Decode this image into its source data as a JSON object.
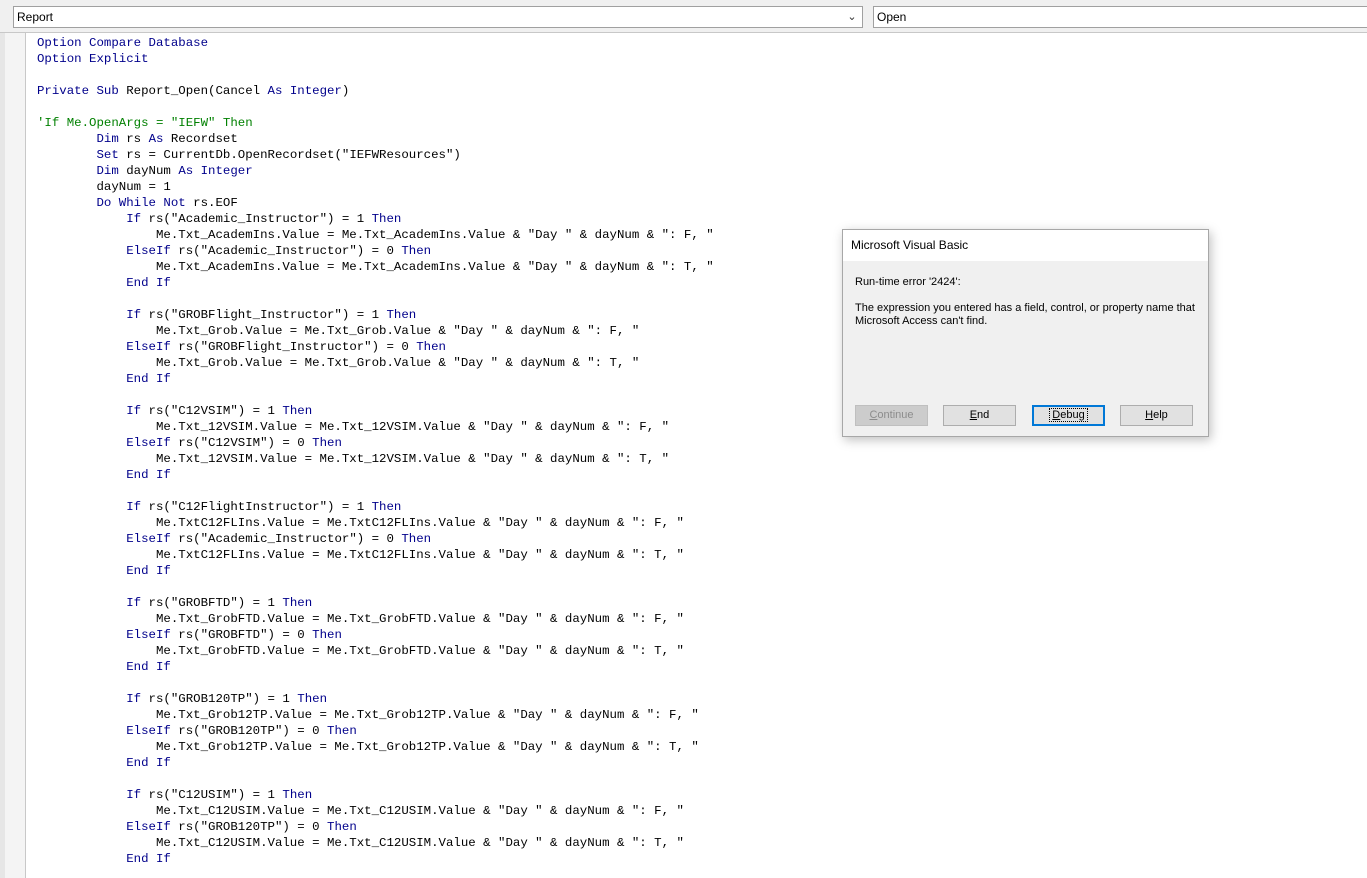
{
  "toolbar": {
    "object_combo": "Report",
    "procedure_combo": "Open"
  },
  "code_lines": [
    [
      {
        "t": "Option Compare Database",
        "c": "kw"
      }
    ],
    [
      {
        "t": "Option Explicit",
        "c": "kw"
      }
    ],
    [
      {
        "t": "",
        "c": ""
      }
    ],
    [
      {
        "t": "Private Sub",
        "c": "kw"
      },
      {
        "t": " Report_Open(Cancel ",
        "c": ""
      },
      {
        "t": "As Integer",
        "c": "kw"
      },
      {
        "t": ")",
        "c": ""
      }
    ],
    [
      {
        "t": "",
        "c": ""
      }
    ],
    [
      {
        "t": "'If Me.OpenArgs = \"IEFW\" Then",
        "c": "cm"
      }
    ],
    [
      {
        "t": "        ",
        "c": ""
      },
      {
        "t": "Dim",
        "c": "kw"
      },
      {
        "t": " rs ",
        "c": ""
      },
      {
        "t": "As",
        "c": "kw"
      },
      {
        "t": " Recordset",
        "c": ""
      }
    ],
    [
      {
        "t": "        ",
        "c": ""
      },
      {
        "t": "Set",
        "c": "kw"
      },
      {
        "t": " rs = CurrentDb.OpenRecordset(\"IEFWResources\")",
        "c": ""
      }
    ],
    [
      {
        "t": "        ",
        "c": ""
      },
      {
        "t": "Dim",
        "c": "kw"
      },
      {
        "t": " dayNum ",
        "c": ""
      },
      {
        "t": "As Integer",
        "c": "kw"
      }
    ],
    [
      {
        "t": "        dayNum = 1",
        "c": ""
      }
    ],
    [
      {
        "t": "        ",
        "c": ""
      },
      {
        "t": "Do While Not",
        "c": "kw"
      },
      {
        "t": " rs.EOF",
        "c": ""
      }
    ],
    [
      {
        "t": "            ",
        "c": ""
      },
      {
        "t": "If",
        "c": "kw"
      },
      {
        "t": " rs(\"Academic_Instructor\") = 1 ",
        "c": ""
      },
      {
        "t": "Then",
        "c": "kw"
      }
    ],
    [
      {
        "t": "                Me.Txt_AcademIns.Value = Me.Txt_AcademIns.Value & \"Day \" & dayNum & \": F, \"",
        "c": ""
      }
    ],
    [
      {
        "t": "            ",
        "c": ""
      },
      {
        "t": "ElseIf",
        "c": "kw"
      },
      {
        "t": " rs(\"Academic_Instructor\") = 0 ",
        "c": ""
      },
      {
        "t": "Then",
        "c": "kw"
      }
    ],
    [
      {
        "t": "                Me.Txt_AcademIns.Value = Me.Txt_AcademIns.Value & \"Day \" & dayNum & \": T, \"",
        "c": ""
      }
    ],
    [
      {
        "t": "            ",
        "c": ""
      },
      {
        "t": "End If",
        "c": "kw"
      }
    ],
    [
      {
        "t": "",
        "c": ""
      }
    ],
    [
      {
        "t": "            ",
        "c": ""
      },
      {
        "t": "If",
        "c": "kw"
      },
      {
        "t": " rs(\"GROBFlight_Instructor\") = 1 ",
        "c": ""
      },
      {
        "t": "Then",
        "c": "kw"
      }
    ],
    [
      {
        "t": "                Me.Txt_Grob.Value = Me.Txt_Grob.Value & \"Day \" & dayNum & \": F, \"",
        "c": ""
      }
    ],
    [
      {
        "t": "            ",
        "c": ""
      },
      {
        "t": "ElseIf",
        "c": "kw"
      },
      {
        "t": " rs(\"GROBFlight_Instructor\") = 0 ",
        "c": ""
      },
      {
        "t": "Then",
        "c": "kw"
      }
    ],
    [
      {
        "t": "                Me.Txt_Grob.Value = Me.Txt_Grob.Value & \"Day \" & dayNum & \": T, \"",
        "c": ""
      }
    ],
    [
      {
        "t": "            ",
        "c": ""
      },
      {
        "t": "End If",
        "c": "kw"
      }
    ],
    [
      {
        "t": "",
        "c": ""
      }
    ],
    [
      {
        "t": "            ",
        "c": ""
      },
      {
        "t": "If",
        "c": "kw"
      },
      {
        "t": " rs(\"C12VSIM\") = 1 ",
        "c": ""
      },
      {
        "t": "Then",
        "c": "kw"
      }
    ],
    [
      {
        "t": "                Me.Txt_12VSIM.Value = Me.Txt_12VSIM.Value & \"Day \" & dayNum & \": F, \"",
        "c": ""
      }
    ],
    [
      {
        "t": "            ",
        "c": ""
      },
      {
        "t": "ElseIf",
        "c": "kw"
      },
      {
        "t": " rs(\"C12VSIM\") = 0 ",
        "c": ""
      },
      {
        "t": "Then",
        "c": "kw"
      }
    ],
    [
      {
        "t": "                Me.Txt_12VSIM.Value = Me.Txt_12VSIM.Value & \"Day \" & dayNum & \": T, \"",
        "c": ""
      }
    ],
    [
      {
        "t": "            ",
        "c": ""
      },
      {
        "t": "End If",
        "c": "kw"
      }
    ],
    [
      {
        "t": "",
        "c": ""
      }
    ],
    [
      {
        "t": "            ",
        "c": ""
      },
      {
        "t": "If",
        "c": "kw"
      },
      {
        "t": " rs(\"C12FlightInstructor\") = 1 ",
        "c": ""
      },
      {
        "t": "Then",
        "c": "kw"
      }
    ],
    [
      {
        "t": "                Me.TxtC12FLIns.Value = Me.TxtC12FLIns.Value & \"Day \" & dayNum & \": F, \"",
        "c": ""
      }
    ],
    [
      {
        "t": "            ",
        "c": ""
      },
      {
        "t": "ElseIf",
        "c": "kw"
      },
      {
        "t": " rs(\"Academic_Instructor\") = 0 ",
        "c": ""
      },
      {
        "t": "Then",
        "c": "kw"
      }
    ],
    [
      {
        "t": "                Me.TxtC12FLIns.Value = Me.TxtC12FLIns.Value & \"Day \" & dayNum & \": T, \"",
        "c": ""
      }
    ],
    [
      {
        "t": "            ",
        "c": ""
      },
      {
        "t": "End If",
        "c": "kw"
      }
    ],
    [
      {
        "t": "",
        "c": ""
      }
    ],
    [
      {
        "t": "            ",
        "c": ""
      },
      {
        "t": "If",
        "c": "kw"
      },
      {
        "t": " rs(\"GROBFTD\") = 1 ",
        "c": ""
      },
      {
        "t": "Then",
        "c": "kw"
      }
    ],
    [
      {
        "t": "                Me.Txt_GrobFTD.Value = Me.Txt_GrobFTD.Value & \"Day \" & dayNum & \": F, \"",
        "c": ""
      }
    ],
    [
      {
        "t": "            ",
        "c": ""
      },
      {
        "t": "ElseIf",
        "c": "kw"
      },
      {
        "t": " rs(\"GROBFTD\") = 0 ",
        "c": ""
      },
      {
        "t": "Then",
        "c": "kw"
      }
    ],
    [
      {
        "t": "                Me.Txt_GrobFTD.Value = Me.Txt_GrobFTD.Value & \"Day \" & dayNum & \": T, \"",
        "c": ""
      }
    ],
    [
      {
        "t": "            ",
        "c": ""
      },
      {
        "t": "End If",
        "c": "kw"
      }
    ],
    [
      {
        "t": "",
        "c": ""
      }
    ],
    [
      {
        "t": "            ",
        "c": ""
      },
      {
        "t": "If",
        "c": "kw"
      },
      {
        "t": " rs(\"GROB120TP\") = 1 ",
        "c": ""
      },
      {
        "t": "Then",
        "c": "kw"
      }
    ],
    [
      {
        "t": "                Me.Txt_Grob12TP.Value = Me.Txt_Grob12TP.Value & \"Day \" & dayNum & \": F, \"",
        "c": ""
      }
    ],
    [
      {
        "t": "            ",
        "c": ""
      },
      {
        "t": "ElseIf",
        "c": "kw"
      },
      {
        "t": " rs(\"GROB120TP\") = 0 ",
        "c": ""
      },
      {
        "t": "Then",
        "c": "kw"
      }
    ],
    [
      {
        "t": "                Me.Txt_Grob12TP.Value = Me.Txt_Grob12TP.Value & \"Day \" & dayNum & \": T, \"",
        "c": ""
      }
    ],
    [
      {
        "t": "            ",
        "c": ""
      },
      {
        "t": "End If",
        "c": "kw"
      }
    ],
    [
      {
        "t": "",
        "c": ""
      }
    ],
    [
      {
        "t": "            ",
        "c": ""
      },
      {
        "t": "If",
        "c": "kw"
      },
      {
        "t": " rs(\"C12USIM\") = 1 ",
        "c": ""
      },
      {
        "t": "Then",
        "c": "kw"
      }
    ],
    [
      {
        "t": "                Me.Txt_C12USIM.Value = Me.Txt_C12USIM.Value & \"Day \" & dayNum & \": F, \"",
        "c": ""
      }
    ],
    [
      {
        "t": "            ",
        "c": ""
      },
      {
        "t": "ElseIf",
        "c": "kw"
      },
      {
        "t": " rs(\"GROB120TP\") = 0 ",
        "c": ""
      },
      {
        "t": "Then",
        "c": "kw"
      }
    ],
    [
      {
        "t": "                Me.Txt_C12USIM.Value = Me.Txt_C12USIM.Value & \"Day \" & dayNum & \": T, \"",
        "c": ""
      }
    ],
    [
      {
        "t": "            ",
        "c": ""
      },
      {
        "t": "End If",
        "c": "kw"
      }
    ]
  ],
  "dialog": {
    "title": "Microsoft Visual Basic",
    "error": "Run-time error '2424':",
    "message": "The expression you entered has a field, control, or property name that Microsoft Access can't find.",
    "buttons": {
      "continue": {
        "mnemonic": "C",
        "rest": "ontinue"
      },
      "end": {
        "mnemonic": "E",
        "rest": "nd"
      },
      "debug": {
        "mnemonic": "D",
        "rest": "ebug"
      },
      "help": {
        "mnemonic": "H",
        "rest": "elp"
      }
    }
  },
  "colors": {
    "keyword": "#00008b",
    "comment": "#008000",
    "default_button_border": "#0078d7"
  }
}
